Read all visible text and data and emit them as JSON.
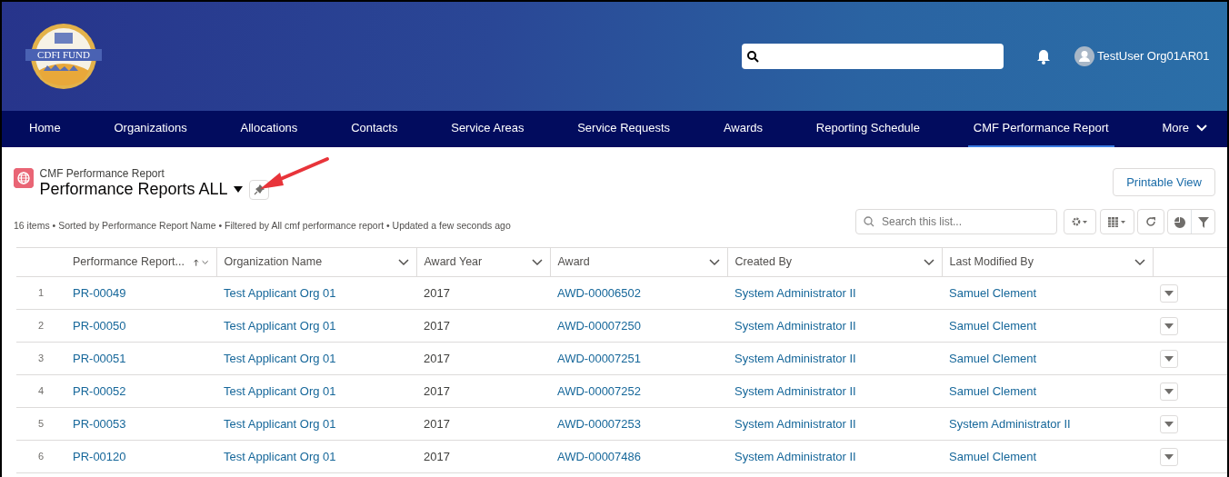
{
  "header": {
    "logo_text": "CDFI FUND",
    "user": "TestUser Org01AR01"
  },
  "nav": [
    {
      "label": "Home",
      "selected": false,
      "kind": "link"
    },
    {
      "label": "Organizations",
      "selected": false,
      "kind": "link"
    },
    {
      "label": "Allocations",
      "selected": false,
      "kind": "link"
    },
    {
      "label": "Contacts",
      "selected": false,
      "kind": "link"
    },
    {
      "label": "Service Areas",
      "selected": false,
      "kind": "link"
    },
    {
      "label": "Service Requests",
      "selected": false,
      "kind": "link"
    },
    {
      "label": "Awards",
      "selected": false,
      "kind": "link"
    },
    {
      "label": "Reporting Schedule",
      "selected": false,
      "kind": "link"
    },
    {
      "label": "CMF Performance Report",
      "selected": true,
      "kind": "link"
    },
    {
      "label": "More",
      "selected": false,
      "kind": "menu"
    }
  ],
  "list_view": {
    "object_label": "CMF Performance Report",
    "title": "Performance Reports ALL",
    "printable_button": "Printable View",
    "summary": "16 items • Sorted by Performance Report Name • Filtered by All cmf performance report • Updated a few seconds ago",
    "search": {
      "placeholder": "Search this list..."
    }
  },
  "table": {
    "columns": [
      {
        "label": "Performance Report...",
        "sorted": true
      },
      {
        "label": "Organization Name",
        "sorted": false
      },
      {
        "label": "Award Year",
        "sorted": false
      },
      {
        "label": "Award",
        "sorted": false
      },
      {
        "label": "Created By",
        "sorted": false
      },
      {
        "label": "Last Modified By",
        "sorted": false
      }
    ],
    "rows": [
      {
        "number": "1",
        "cells": [
          "PR-00049",
          "Test Applicant Org 01",
          "2017",
          "AWD-00006502",
          "System Administrator II",
          "Samuel Clement"
        ]
      },
      {
        "number": "2",
        "cells": [
          "PR-00050",
          "Test Applicant Org 01",
          "2017",
          "AWD-00007250",
          "System Administrator II",
          "Samuel Clement"
        ]
      },
      {
        "number": "3",
        "cells": [
          "PR-00051",
          "Test Applicant Org 01",
          "2017",
          "AWD-00007251",
          "System Administrator II",
          "Samuel Clement"
        ]
      },
      {
        "number": "4",
        "cells": [
          "PR-00052",
          "Test Applicant Org 01",
          "2017",
          "AWD-00007252",
          "System Administrator II",
          "Samuel Clement"
        ]
      },
      {
        "number": "5",
        "cells": [
          "PR-00053",
          "Test Applicant Org 01",
          "2017",
          "AWD-00007253",
          "System Administrator II",
          "System Administrator II"
        ]
      },
      {
        "number": "6",
        "cells": [
          "PR-00120",
          "Test Applicant Org 01",
          "2017",
          "AWD-00007486",
          "System Administrator II",
          "Samuel Clement"
        ]
      }
    ]
  }
}
